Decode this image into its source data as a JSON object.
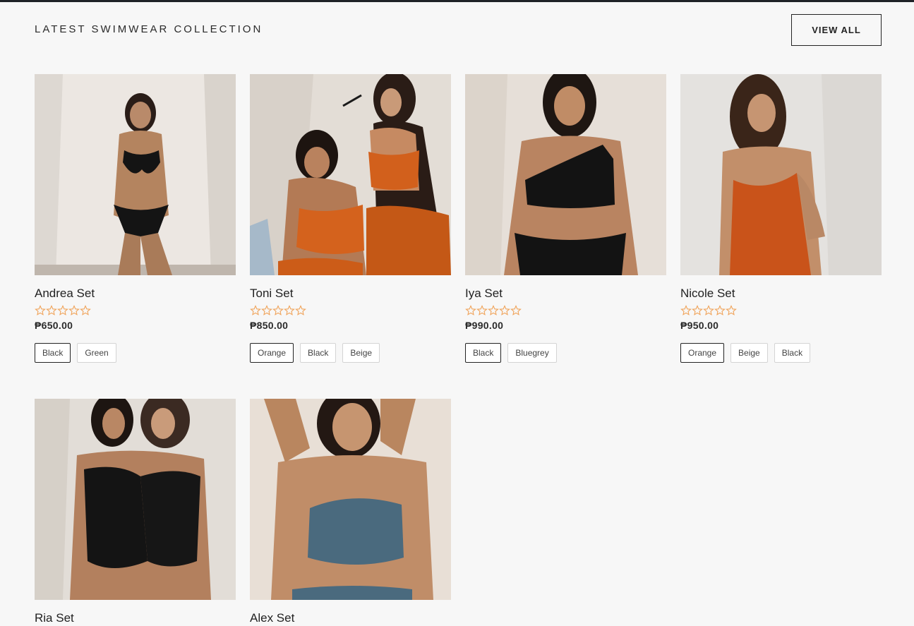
{
  "section": {
    "title": "LATEST SWIMWEAR COLLECTION",
    "view_all_label": "VIEW ALL"
  },
  "colors": {
    "star": "#f0a35a",
    "accent_dark": "#232323",
    "background": "#f7f7f7"
  },
  "products": [
    {
      "name": "Andrea Set",
      "rating": 0,
      "price": "₱650.00",
      "variants": [
        "Black",
        "Green"
      ],
      "selected_variant": "Black"
    },
    {
      "name": "Toni Set",
      "rating": 0,
      "price": "₱850.00",
      "variants": [
        "Orange",
        "Black",
        "Beige"
      ],
      "selected_variant": "Orange"
    },
    {
      "name": "Iya Set",
      "rating": 0,
      "price": "₱990.00",
      "variants": [
        "Black",
        "Bluegrey"
      ],
      "selected_variant": "Black"
    },
    {
      "name": "Nicole Set",
      "rating": 0,
      "price": "₱950.00",
      "variants": [
        "Orange",
        "Beige",
        "Black"
      ],
      "selected_variant": "Orange"
    },
    {
      "name": "Ria Set"
    },
    {
      "name": "Alex Set"
    }
  ]
}
